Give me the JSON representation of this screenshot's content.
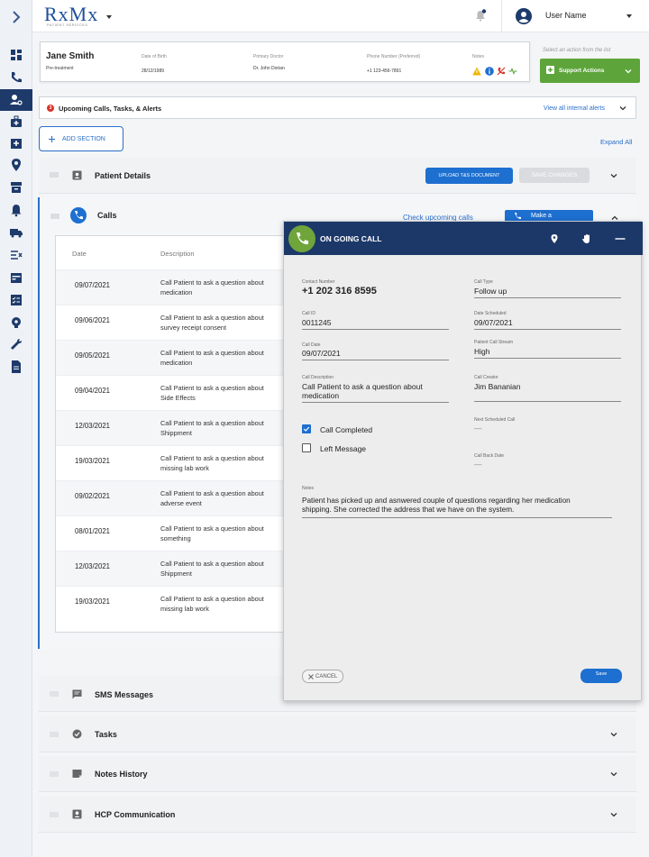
{
  "app": {
    "logo": "RxMx",
    "logo_sub": "PATIENT SERVICES"
  },
  "user": {
    "name": "User Name"
  },
  "patient": {
    "name": "Jane Smith",
    "status": "Pre-treatment",
    "dob_label": "Date of Birth",
    "dob": "28/12/1989",
    "doctor_label": "Primary Doctor",
    "doctor": "Dr. John Dorian",
    "phone_label": "Phone Number (Preferred)",
    "phone": "+1 123-456-7891",
    "notes_label": "Notes"
  },
  "support": {
    "hint": "Select an action from the list",
    "label": "Support Actions"
  },
  "alerts": {
    "count": "3",
    "title": "Upcoming Calls, Tasks, & Alerts",
    "link": "View all internal alerts"
  },
  "actions": {
    "add_section": "ADD SECTION",
    "expand_all": "Expand All"
  },
  "sections": {
    "patient_details": {
      "title": "Patient Details",
      "upload": "UPLOAD T&S DOCUMENT",
      "save": "SAVE CHANGES"
    },
    "calls": {
      "title": "Calls",
      "check": "Check upcoming calls",
      "make": "Make a"
    },
    "sms": {
      "title": "SMS Messages"
    },
    "tasks": {
      "title": "Tasks"
    },
    "notes": {
      "title": "Notes History"
    },
    "hcp": {
      "title": "HCP Communication"
    }
  },
  "calls_table": {
    "headers": {
      "date": "Date",
      "description": "Description"
    },
    "rows": [
      {
        "date": "09/07/2021",
        "line1": "Call Patient to ask a question about",
        "line2": "medication"
      },
      {
        "date": "09/06/2021",
        "line1": "Call Patient to ask a question about",
        "line2": "survey receipt consent"
      },
      {
        "date": "09/05/2021",
        "line1": "Call Patient to ask a question about",
        "line2": "medication"
      },
      {
        "date": "09/04/2021",
        "line1": "Call Patient to ask a question about",
        "line2": "Side Effects"
      },
      {
        "date": "12/03/2021",
        "line1": "Call Patient to ask a question about",
        "line2": "Shippment"
      },
      {
        "date": "19/03/2021",
        "line1": "Call Patient to ask a question about",
        "line2": "missing lab work"
      },
      {
        "date": "09/02/2021",
        "line1": "Call Patient to ask a question about",
        "line2": "adverse event"
      },
      {
        "date": "08/01/2021",
        "line1": "Call Patient to ask a question about",
        "line2": "something"
      },
      {
        "date": "12/03/2021",
        "line1": "Call Patient to ask a question about",
        "line2": "Shippment"
      },
      {
        "date": "19/03/2021",
        "line1": "Call Patient to ask a question about",
        "line2": "missing lab work"
      }
    ]
  },
  "call_popup": {
    "title": "ON GOING CALL",
    "contact_label": "Contact Number",
    "contact": "+1 202 316 8595",
    "type_label": "Call Type",
    "type": "Follow up",
    "id_label": "Call ID",
    "id": "0011245",
    "scheduled_label": "Date Scheduled",
    "scheduled": "09/07/2021",
    "date_label": "Call Date",
    "date": "09/07/2021",
    "stream_label": "Patient Call Stream",
    "stream": "High",
    "desc_label": "Call Description",
    "desc1": "Call Patient to ask a question about",
    "desc2": "medication",
    "creator_label": "Call Creator",
    "creator": "Jim Bananian",
    "next_label": "Next Scheduled Call",
    "next": "—",
    "completed_label": "Call Completed",
    "completed": true,
    "left_msg_label": "Left Message",
    "left_msg": false,
    "callback_label": "Call Back Date",
    "callback": "—",
    "notes_label": "Notes",
    "notes1": "Patient has picked up and asnwered couple of questions regarding her medication",
    "notes2": "shipping. She corrected the address that we have on the system.",
    "cancel": "CANCEL",
    "save": "Save"
  },
  "colors": {
    "navy": "#1c3869",
    "primary": "#1d6fd0",
    "success": "#5da53b",
    "alert": "#d9342b"
  }
}
